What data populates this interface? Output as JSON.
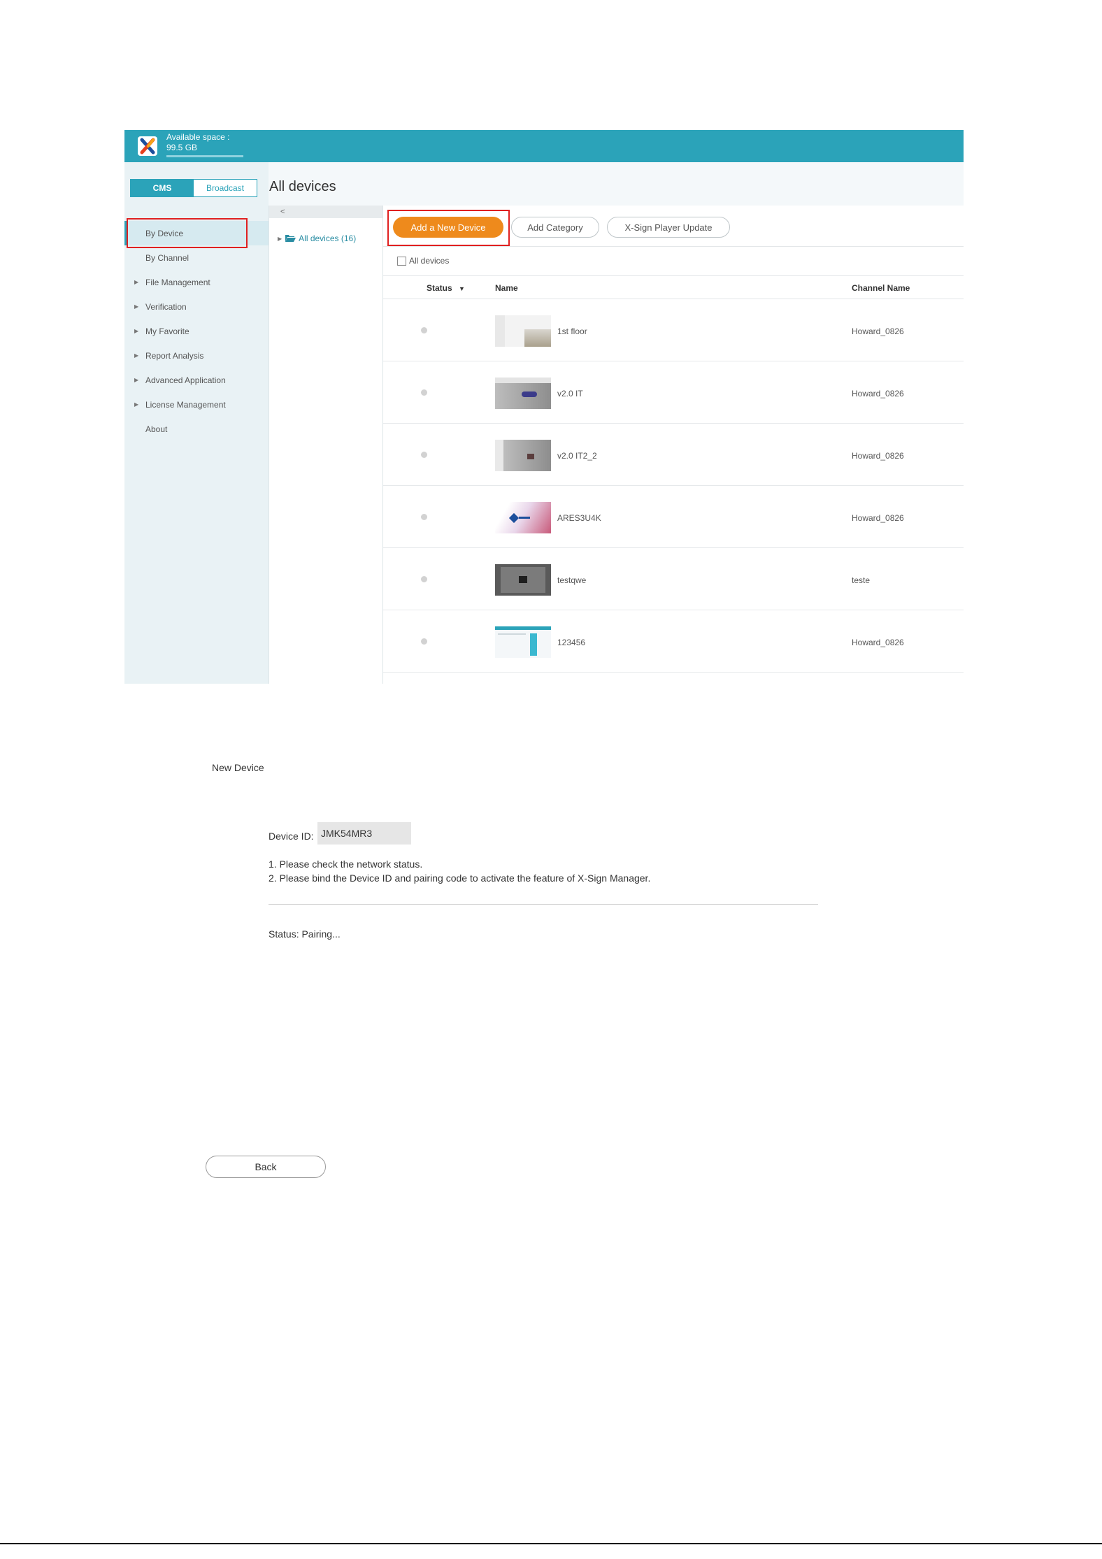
{
  "header": {
    "space_label": "Available space :",
    "space_value": "99.5 GB"
  },
  "sidebar": {
    "mode_cms": "CMS",
    "mode_broadcast": "Broadcast",
    "items": [
      {
        "label": "By Device"
      },
      {
        "label": "By Channel"
      },
      {
        "label": "File Management"
      },
      {
        "label": "Verification"
      },
      {
        "label": "My Favorite"
      },
      {
        "label": "Report Analysis"
      },
      {
        "label": "Advanced Application"
      },
      {
        "label": "License Management"
      },
      {
        "label": "About"
      }
    ]
  },
  "page_title": "All devices",
  "tree": {
    "collapse": "<",
    "root": "All devices (16)"
  },
  "toolbar": {
    "add": "Add a New Device",
    "category": "Add Category",
    "update": "X-Sign Player Update"
  },
  "table": {
    "select_all": "All devices",
    "headers": {
      "status": "Status",
      "name": "Name",
      "channel": "Channel Name"
    },
    "rows": [
      {
        "name": "1st floor",
        "channel": "Howard_0826"
      },
      {
        "name": "v2.0 IT",
        "channel": "Howard_0826"
      },
      {
        "name": "v2.0 IT2_2",
        "channel": "Howard_0826"
      },
      {
        "name": "ARES3U4K",
        "channel": "Howard_0826"
      },
      {
        "name": "testqwe",
        "channel": "teste"
      },
      {
        "name": "123456",
        "channel": "Howard_0826"
      }
    ]
  },
  "dialog": {
    "title": "New Device",
    "device_id_label": "Device ID:",
    "device_id_value": "JMK54MR3",
    "step1": "1. Please check the network status.",
    "step2": "2. Please bind the Device ID and pairing code to activate the feature of X-Sign Manager.",
    "status": "Status:  Pairing...",
    "back": "Back"
  },
  "colors": {
    "accent": "#2ba3b9",
    "primary_button": "#ee8a1c",
    "highlight_box": "#e02020"
  },
  "icons": {
    "logo": "x-sign-logo-icon",
    "folder": "folder-open-icon",
    "sort": "sort-down-icon",
    "caret": "caret-right-icon"
  }
}
